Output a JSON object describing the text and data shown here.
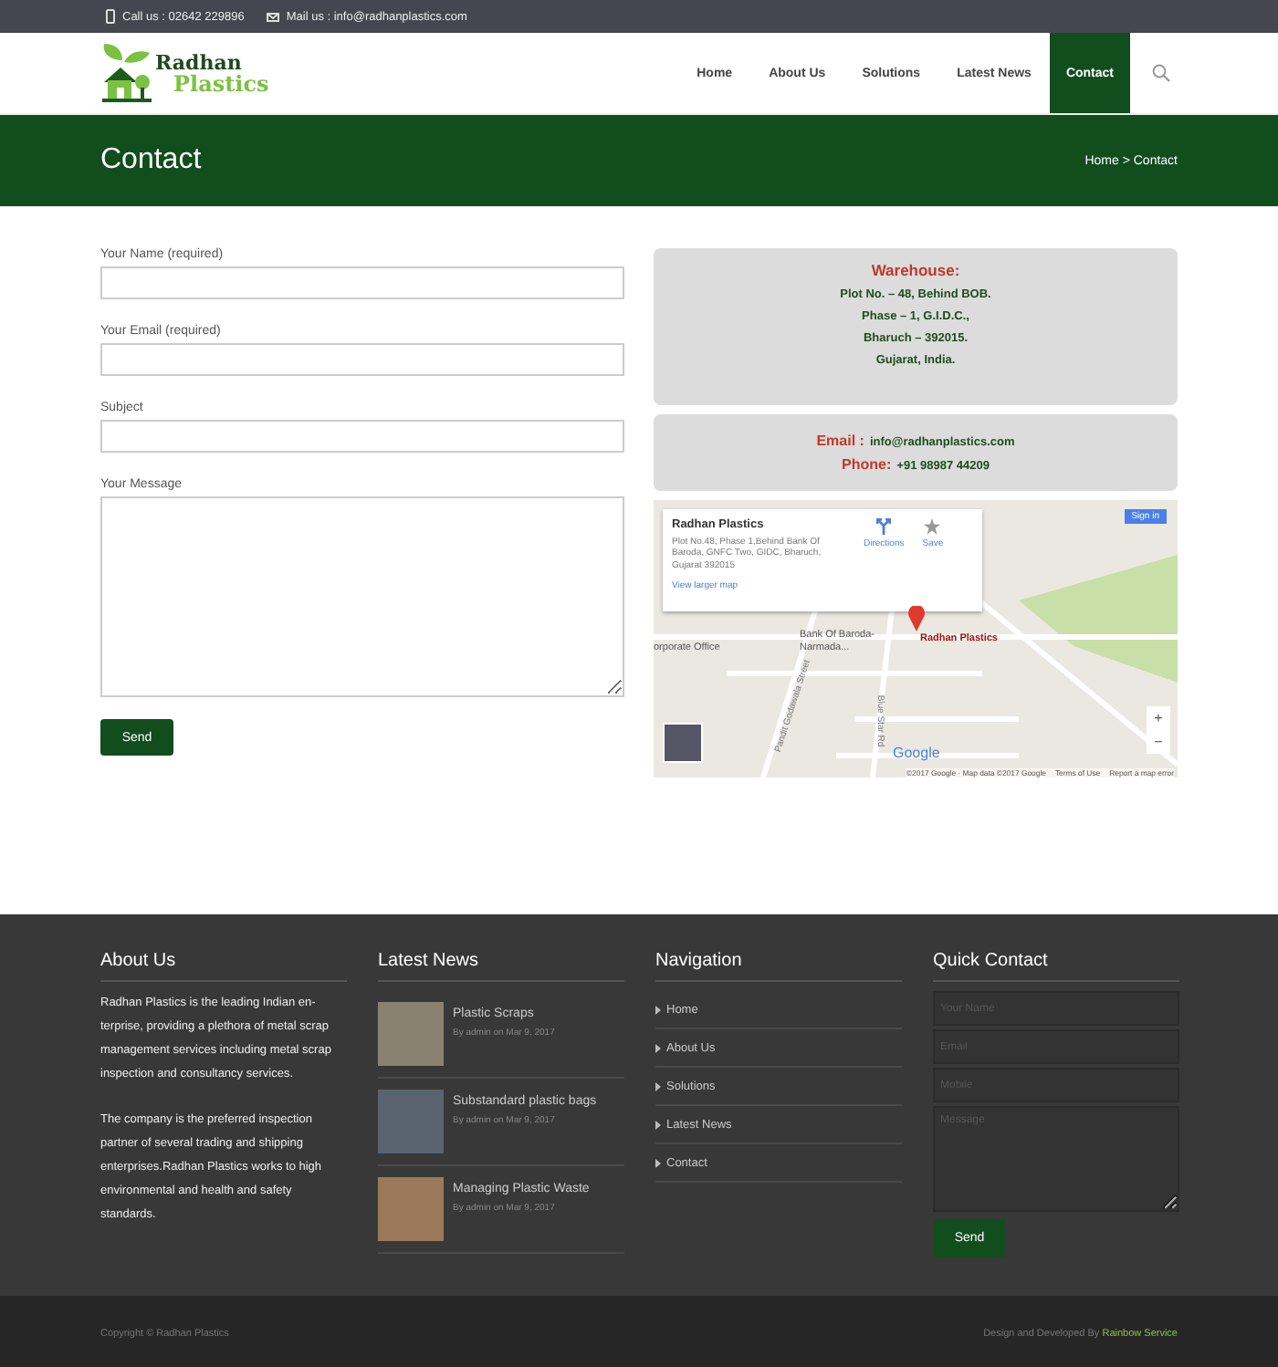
{
  "top_bar": {
    "phone": "Call us : 02642 229896",
    "mail": "Mail us : info@radhanplastics.com"
  },
  "header": {
    "logo": {
      "line1": "Radhan",
      "line2": "Plastics"
    },
    "nav": [
      {
        "label": "Home",
        "selected": false
      },
      {
        "label": "About Us",
        "selected": false
      },
      {
        "label": "Solutions",
        "selected": false
      },
      {
        "label": "Latest News",
        "selected": false
      },
      {
        "label": "Contact",
        "selected": true
      }
    ]
  },
  "banner": {
    "title": "Contact",
    "breadcrumb": "Home > Contact"
  },
  "form": {
    "fields": [
      {
        "label": "Your Name (required)",
        "kind": "input"
      },
      {
        "label": "Your Email (required)",
        "kind": "input"
      },
      {
        "label": "Subject",
        "kind": "input"
      },
      {
        "label": "Your Message",
        "kind": "textarea"
      }
    ],
    "button": "Send"
  },
  "warehouse": {
    "heading": "Warehouse:",
    "lines": [
      "Plot No. – 48, Behind BOB.",
      "Phase – 1, G.I.D.C.,",
      "Bharuch – 392015.",
      "Gujarat, India."
    ]
  },
  "contact_box": {
    "email_label": "Email :",
    "email": "info@radhanplastics.com",
    "phone_label": "Phone:",
    "phone": "+91 98987 44209"
  },
  "map": {
    "place_name": "Radhan Plastics",
    "address": "Plot No.48, Phase 1,Behind Bank Of Baroda, GNFC Two, GIDC, Bharuch, Gujarat 392015",
    "directions": "Directions",
    "save": "Save",
    "larger": "View larger map",
    "sign_in": "Sign in",
    "office": "orporate Office",
    "bank": "Bank Of Baroda-Narmada...",
    "marker_label": "Radhan Plastics",
    "street_1": "Pandit Godawala Street",
    "street_2": "Blue Star Rd",
    "zoom_in": "+",
    "zoom_out": "−",
    "logo": "Google",
    "attribution": "©2017 Google · Map data ©2017 Google",
    "terms": "Terms of Use",
    "report": "Report a map error"
  },
  "footer": {
    "about": {
      "heading": "About Us",
      "paragraphs": [
        "Radhan Plastics is the leading Indian en-terprise, providing a plethora of metal scrap management services including metal scrap inspection and consultancy services.",
        "The company is the preferred inspection partner of several trading and shipping enterprises.Radhan Plastics works to high environmental and health and safety standards."
      ]
    },
    "news": {
      "heading": "Latest News",
      "items": [
        {
          "title": "Plastic Scraps",
          "meta": "By admin on Mar 9, 2017"
        },
        {
          "title": "Substandard plastic bags",
          "meta": "By admin on Mar 9, 2017"
        },
        {
          "title": "Managing Plastic Waste",
          "meta": "By admin on Mar 9, 2017"
        }
      ]
    },
    "navigation": {
      "heading": "Navigation",
      "items": [
        "Home",
        "About Us",
        "Solutions",
        "Latest News",
        "Contact"
      ]
    },
    "quick_contact": {
      "heading": "Quick Contact",
      "fields": [
        {
          "placeholder": "Your Name",
          "kind": "input"
        },
        {
          "placeholder": "Email",
          "kind": "input"
        },
        {
          "placeholder": "Mobile",
          "kind": "input"
        },
        {
          "placeholder": "Message",
          "kind": "textarea"
        }
      ],
      "button": "Send"
    }
  },
  "bottom_bar": {
    "copyright": "Copyright © Radhan Plastics",
    "credit": "Design and Developed By",
    "credit_link": "Rainbow Service"
  }
}
